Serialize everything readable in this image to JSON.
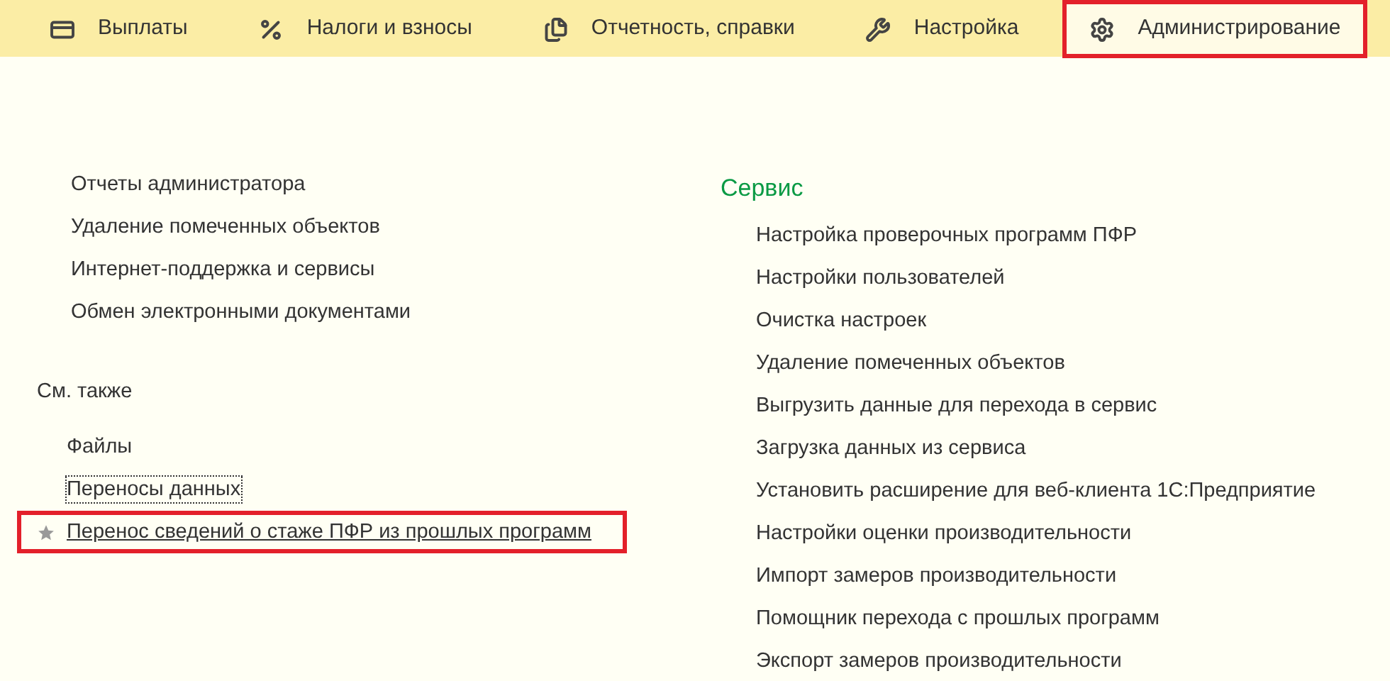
{
  "tabs": [
    {
      "label": "Выплаты",
      "kind": "card",
      "selected": false,
      "highlighted": false
    },
    {
      "label": "Налоги и взносы",
      "kind": "percent",
      "selected": false,
      "highlighted": false
    },
    {
      "label": "Отчетность, справки",
      "kind": "files",
      "selected": false,
      "highlighted": false
    },
    {
      "label": "Настройка",
      "kind": "wrench",
      "selected": false,
      "highlighted": false
    },
    {
      "label": "Администрирование",
      "kind": "gear",
      "selected": true,
      "highlighted": true
    }
  ],
  "left_links": [
    {
      "label": "Отчеты администратора"
    },
    {
      "label": "Удаление помеченных объектов"
    },
    {
      "label": "Интернет-поддержка и сервисы"
    },
    {
      "label": "Обмен электронными документами"
    }
  ],
  "see_also": {
    "title": "См. также",
    "items": [
      {
        "label": "Файлы",
        "focused": false,
        "starred": false,
        "highlighted": false
      },
      {
        "label": "Переносы данных",
        "focused": true,
        "starred": false,
        "highlighted": false
      },
      {
        "label": "Перенос сведений о стаже ПФР из прошлых программ",
        "focused": false,
        "starred": true,
        "highlighted": true
      }
    ]
  },
  "service": {
    "title": "Сервис",
    "items": [
      {
        "label": "Настройка проверочных программ ПФР"
      },
      {
        "label": "Настройки пользователей"
      },
      {
        "label": "Очистка настроек"
      },
      {
        "label": "Удаление помеченных объектов"
      },
      {
        "label": "Выгрузить данные для перехода в сервис"
      },
      {
        "label": "Загрузка данных из сервиса"
      },
      {
        "label": "Установить расширение для веб-клиента 1С:Предприятие"
      },
      {
        "label": "Настройки оценки производительности"
      },
      {
        "label": "Импорт замеров производительности"
      },
      {
        "label": "Помощник перехода с прошлых программ"
      },
      {
        "label": "Экспорт замеров производительности"
      }
    ]
  }
}
